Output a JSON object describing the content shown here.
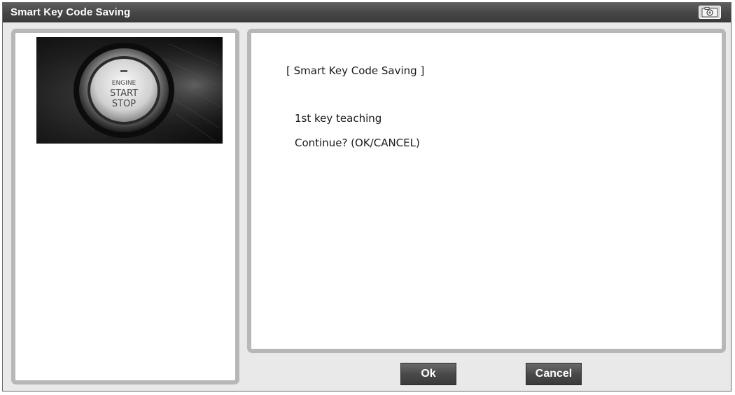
{
  "window": {
    "title": "Smart Key Code Saving",
    "title_icon": "camera-icon"
  },
  "left_panel": {
    "image": {
      "subject": "engine-start-stop-button",
      "button_text": [
        "ENGINE",
        "START",
        "STOP"
      ]
    }
  },
  "message": {
    "heading": "[ Smart Key Code Saving ]",
    "line1": "1st key teaching",
    "line2": "Continue? (OK/CANCEL)"
  },
  "buttons": {
    "ok_label": "Ok",
    "cancel_label": "Cancel"
  },
  "colors": {
    "titlebar": "#464646",
    "panel_border": "#b7b7b7",
    "button": "#4a4a4a"
  }
}
